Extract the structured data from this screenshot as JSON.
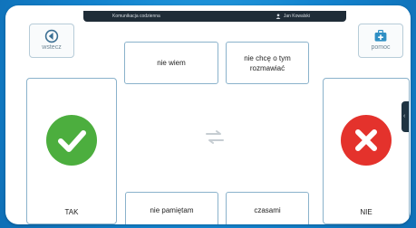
{
  "statusbar": {
    "title": "Komunikacja codzienna",
    "user": "Jan Kowalski"
  },
  "toolbar": {
    "back_label": "wstecz",
    "help_label": "pomoc"
  },
  "answers": [
    {
      "label": "nie wiem"
    },
    {
      "label": "nie chcę o tym rozmawiać"
    },
    {
      "label": "nie pamiętam"
    },
    {
      "label": "czasami"
    }
  ],
  "yes_card": {
    "label": "TAK",
    "icon": "check-icon",
    "color": "#4cae3e"
  },
  "no_card": {
    "label": "NIE",
    "icon": "x-icon",
    "color": "#e4322c"
  },
  "side_tab": {
    "icon": "chevron-left-icon",
    "glyph": "‹"
  }
}
